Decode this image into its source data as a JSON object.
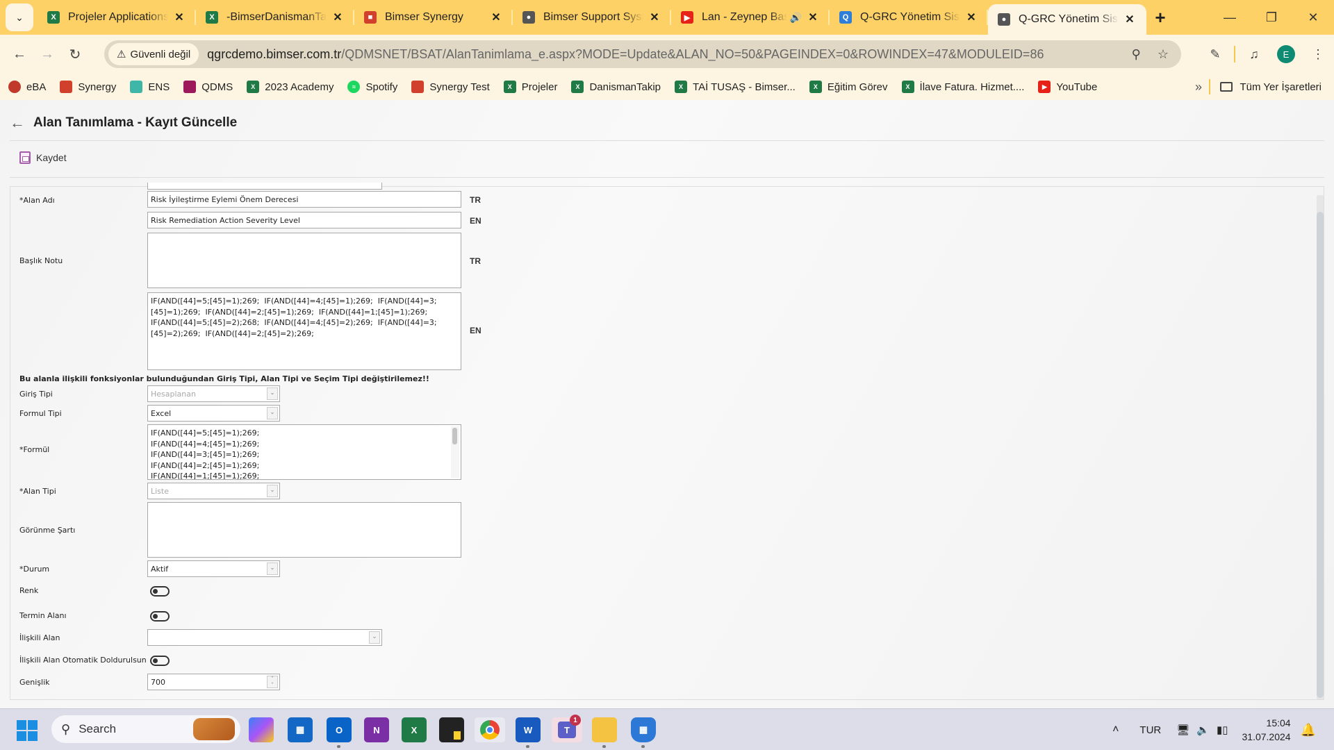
{
  "browser": {
    "tabs": [
      {
        "title": "Projeler Applications",
        "icon": "excel-icon",
        "color": "#1f7a45"
      },
      {
        "title": "-BimserDanismanTakip",
        "icon": "excel-icon",
        "color": "#1f7a45"
      },
      {
        "title": "Bimser Synergy",
        "icon": "synergy-icon",
        "color": "#d0402c"
      },
      {
        "title": "Bimser Support System",
        "icon": "globe-icon",
        "color": "#555555"
      },
      {
        "title": "Lan - Zeynep Bastık",
        "icon": "youtube-icon",
        "color": "#e62117",
        "audio": true
      },
      {
        "title": "Q-GRC Yönetim Sistemi",
        "icon": "qgrc-icon",
        "color": "#2f7fd8"
      },
      {
        "title": "Q-GRC Yönetim Sistemi",
        "icon": "globe-icon",
        "color": "#555555",
        "active": true
      }
    ],
    "security_label": "Güvenli değil",
    "url_host": "qgrcdemo.bimser.com.tr",
    "url_path": "/QDMSNET/BSAT/AlanTanimlama_e.aspx?MODE=Update&ALAN_NO=50&PAGEINDEX=0&ROWINDEX=47&MODULEID=86",
    "profile_initial": "E",
    "bookmarks": [
      {
        "label": "eBA",
        "icon": "eba-icon",
        "color": "#c0392b"
      },
      {
        "label": "Synergy",
        "icon": "synergy-icon",
        "color": "#d0402c"
      },
      {
        "label": "ENS",
        "icon": "ens-icon",
        "color": "#3fb7a8"
      },
      {
        "label": "QDMS",
        "icon": "qdms-icon",
        "color": "#9c1a5c"
      },
      {
        "label": "2023 Academy",
        "icon": "excel-icon",
        "color": "#1f7a45"
      },
      {
        "label": "Spotify",
        "icon": "spotify-icon",
        "color": "#1ed760"
      },
      {
        "label": "Synergy Test",
        "icon": "synergy-icon",
        "color": "#d0402c"
      },
      {
        "label": "Projeler",
        "icon": "excel-icon",
        "color": "#1f7a45"
      },
      {
        "label": "DanismanTakip",
        "icon": "excel-icon",
        "color": "#1f7a45"
      },
      {
        "label": "TAİ TUSAŞ - Bimser...",
        "icon": "excel-icon",
        "color": "#1f7a45"
      },
      {
        "label": "Eğitim Görev",
        "icon": "excel-icon",
        "color": "#1f7a45"
      },
      {
        "label": "İlave Fatura. Hizmet....",
        "icon": "excel-icon",
        "color": "#1f7a45"
      },
      {
        "label": "YouTube",
        "icon": "youtube-icon",
        "color": "#e62117"
      }
    ],
    "all_bookmarks_label": "Tüm Yer İşaretleri"
  },
  "page": {
    "title": "Alan Tanımlama - Kayıt Güncelle",
    "save_label": "Kaydet",
    "form": {
      "alan_adi_label": "*Alan Adı",
      "alan_adi_tr": "Risk İyileştirme Eylemi Önem Derecesi",
      "alan_adi_en": "Risk Remediation Action Severity Level",
      "lang_tr": "TR",
      "lang_en": "EN",
      "baslik_notu_label": "Başlık Notu",
      "baslik_notu_tr": "",
      "baslik_notu_en": "IF(AND([44]=5;[45]=1);269;  IF(AND([44]=4;[45]=1);269;  IF(AND([44]=3;\n[45]=1);269;  IF(AND([44]=2;[45]=1);269;  IF(AND([44]=1;[45]=1);269;\nIF(AND([44]=5;[45]=2);268;  IF(AND([44]=4;[45]=2);269;  IF(AND([44]=3;\n[45]=2);269;  IF(AND([44]=2;[45]=2);269;",
      "warning": "Bu alanla ilişkili fonksiyonlar bulunduğundan Giriş Tipi, Alan Tipi ve Seçim Tipi değiştirilemez!!",
      "giris_tipi_label": "Giriş Tipi",
      "giris_tipi_value": "Hesaplanan",
      "formul_tipi_label": "Formul Tipi",
      "formul_tipi_value": "Excel",
      "formul_label": "*Formül",
      "formul_value": "IF(AND([44]=5;[45]=1);269;\nIF(AND([44]=4;[45]=1);269;\nIF(AND([44]=3;[45]=1);269;\nIF(AND([44]=2;[45]=1);269;\nIF(AND([44]=1;[45]=1);269;",
      "alan_tipi_label": "*Alan Tipi",
      "alan_tipi_value": "Liste",
      "gorunme_sarti_label": "Görünme Şartı",
      "gorunme_sarti_value": "",
      "durum_label": "*Durum",
      "durum_value": "Aktif",
      "renk_label": "Renk",
      "renk_on": false,
      "termin_label": "Termin Alanı",
      "termin_on": false,
      "iliskili_alan_label": "İlişkili Alan",
      "iliskili_alan_value": "",
      "otomatik_label": "İlişkili Alan Otomatik Doldurulsun",
      "otomatik_on": false,
      "genislik_label": "Genişlik",
      "genislik_value": "700"
    }
  },
  "taskbar": {
    "search_label": "Search",
    "apps": [
      "copilot",
      "widgets",
      "outlook",
      "onenote",
      "excel",
      "sticky-notes",
      "chrome",
      "word",
      "teams",
      "file-explorer",
      "defender"
    ],
    "teams_badge": "1",
    "language": "TUR",
    "time": "15:04",
    "date": "31.07.2024"
  }
}
